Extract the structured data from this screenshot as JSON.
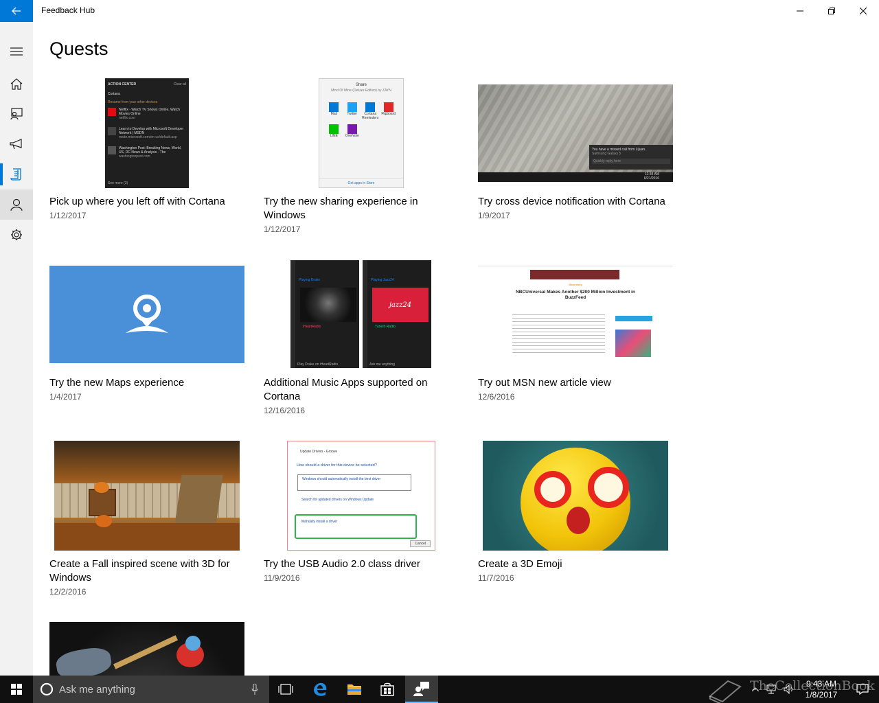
{
  "window": {
    "title": "Feedback Hub"
  },
  "page": {
    "title": "Quests"
  },
  "rail": {
    "items": [
      {
        "icon": "hamburger-menu-icon"
      },
      {
        "icon": "home-icon"
      },
      {
        "icon": "feedback-icon"
      },
      {
        "icon": "announcements-icon"
      },
      {
        "icon": "quests-icon"
      },
      {
        "icon": "profile-icon"
      },
      {
        "icon": "settings-icon"
      }
    ]
  },
  "quests": [
    {
      "title": "Pick up where you left off with Cortana",
      "date": "1/12/2017",
      "thumb": {
        "header": "ACTION CENTER",
        "clear": "Clear all",
        "cortana": "Cortana",
        "resume": "Resume from your other devices",
        "items": [
          {
            "title": "Netflix - Watch TV Shows Online, Watch Movies Online",
            "sub": "netflix.com"
          },
          {
            "title": "Learn to Develop with Microsoft Developer Network | MSDN",
            "sub": "msdn.microsoft.com/en-us/default.asp"
          },
          {
            "title": "Washington Post: Breaking News, World, US, DC News & Analysis - The",
            "sub": "washingtonpost.com"
          }
        ],
        "see_more": "See more (3)"
      }
    },
    {
      "title": "Try the new sharing experience in Windows",
      "date": "1/12/2017",
      "thumb": {
        "header": "Share",
        "sub1": "Mind Of Mine (Deluxe Edition) by ZAYN",
        "apps": [
          "Mail",
          "Twitter",
          "Cortana Reminders",
          "Flipboard",
          "LINE",
          "OneNote"
        ],
        "footer": "Get apps in Store"
      }
    },
    {
      "title": "Try cross device notification with Cortana",
      "date": "1/9/2017",
      "thumb": {
        "toast": "You have a missed call from Lijuan.",
        "toast_sub": "Samsung Galaxy 5",
        "reply": "Quickly reply here",
        "time": "11:34 AM",
        "date": "6/21/2016"
      }
    },
    {
      "title": "Try the new Maps experience",
      "date": "1/4/2017"
    },
    {
      "title": "Additional Music Apps supported on Cortana",
      "date": "12/16/2016",
      "thumb": {
        "left_label": "Playing Drake",
        "left_source": "iHeartRadio",
        "right_label": "Playing Jazz24",
        "right_source": "TuneIn Radio",
        "art_text": "jazz24",
        "left_footer": "Play Drake on iHeartRadio",
        "right_footer": "Ask me anything"
      }
    },
    {
      "title": "Try out MSN new article view",
      "date": "12/6/2016",
      "thumb": {
        "brand": "Bloomberg",
        "headline": "NBCUniversal Makes Another $200 Million Investment in BuzzFeed"
      }
    },
    {
      "title": "Create a Fall inspired scene with 3D for Windows",
      "date": "12/2/2016"
    },
    {
      "title": "Try the USB Audio 2.0 class driver",
      "date": "11/9/2016",
      "thumb": {
        "window_title": "Update Drivers - Groove",
        "question": "How should a driver for this device be selected?",
        "opt1": "Windows should automatically install the best driver",
        "opt2": "Search for updated drivers on Windows Update",
        "opt3": "Manually install a driver",
        "cancel": "Cancel"
      }
    },
    {
      "title": "Create a 3D Emoji",
      "date": "11/7/2016"
    },
    {
      "title": "",
      "date": ""
    }
  ],
  "taskbar": {
    "search_placeholder": "Ask me anything",
    "time": "9:43 AM",
    "date": "1/8/2017",
    "watermark": "TheCollectionBook"
  },
  "colors": {
    "accent": "#0078d7",
    "maps_tile": "#4a90d9",
    "taskbar": "#101010"
  }
}
